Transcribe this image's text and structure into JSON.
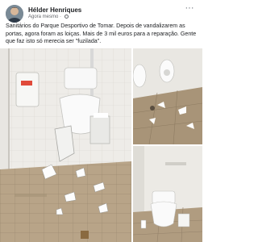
{
  "post": {
    "author": "Hélder Henriques",
    "timestamp": "Agora mesmo",
    "text": "Sanitários do Parque Desportivo de Tomar. Depois de vandalizarem as portas, agora foram as loiças. Mais de 3 mil euros para a reparação. Gente que faz isto só merecia ser \"fuzilada\"."
  },
  "photos": {
    "main_alt_icon": "vandalized-toilet-photo",
    "top_right_icon": "bathroom-floor-debris-photo",
    "bottom_right_icon": "toilet-stall-photo"
  },
  "colors": {
    "text": "#1c1e21",
    "secondary_text": "#65676b",
    "floor_tile": "#b9a58a",
    "wall_tile": "#ecebe7"
  }
}
